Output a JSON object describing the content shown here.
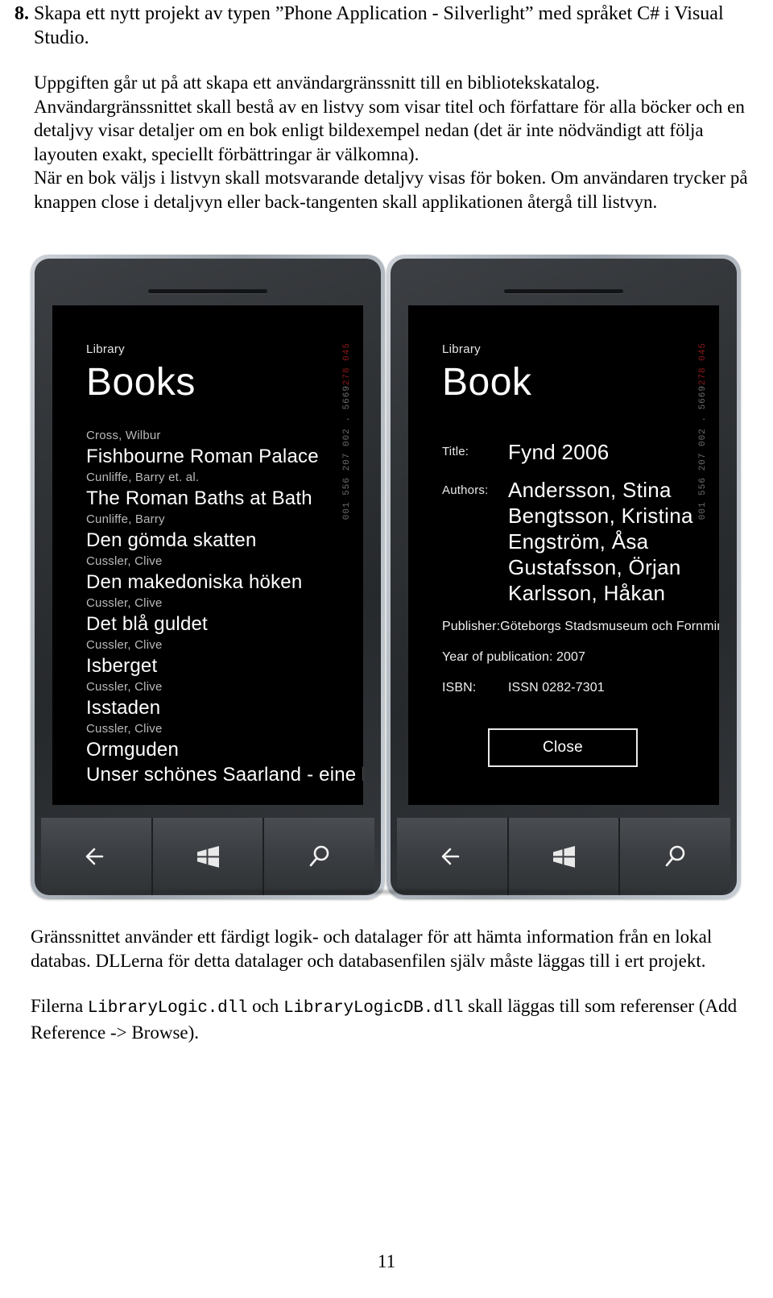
{
  "document": {
    "item_number": "8.",
    "item_text": "Skapa ett nytt projekt av typen ”Phone Application - Silverlight” med språket C#  i Visual Studio.",
    "paragraphs": [
      "Uppgiften går ut på att skapa ett användargränssnitt till en bibliotekskatalog.",
      "Användargränssnittet skall bestå av en listvy som visar titel och författare för alla böcker och en detaljvy visar detaljer om en bok enligt bildexempel nedan (det är inte nödvändigt att följa layouten exakt, speciellt förbättringar är välkomna).",
      "När en bok väljs i listvyn skall motsvarande detaljvy visas för boken. Om användaren trycker på knappen close i detaljvyn eller back-tangenten skall applikationen återgå till listvyn."
    ],
    "after_figure": {
      "paragraph": "Gränssnittet använder ett färdigt logik- och datalager för att hämta information från en lokal databas. DLLerna för detta datalager och databasenfilen själv måste läggas till i ert projekt.",
      "files_prefix": "Filerna ",
      "file_one": "LibraryLogic.dll",
      "files_middle": " och ",
      "file_two": "LibraryLogicDB.dll",
      "files_suffix": " skall läggas till som referenser (Add Reference -> Browse)."
    },
    "page_number": "11"
  },
  "figure": {
    "list_phone": {
      "screen": {
        "app_head": "Library",
        "app_title": "Books",
        "books": [
          {
            "author": "Cross, Wilbur",
            "title": "Fishbourne Roman Palace"
          },
          {
            "author": "Cunliffe, Barry et. al.",
            "title": "The Roman Baths at Bath"
          },
          {
            "author": "Cunliffe, Barry",
            "title": "Den gömda skatten"
          },
          {
            "author": "Cussler, Clive",
            "title": "Den makedoniska höken"
          },
          {
            "author": "Cussler, Clive",
            "title": "Det blå guldet"
          },
          {
            "author": "Cussler, Clive",
            "title": "Isberget"
          },
          {
            "author": "Cussler, Clive",
            "title": "Isstaden"
          },
          {
            "author": "Cussler, Clive",
            "title": "Ormguden"
          },
          {
            "author": "Cussler, Clive",
            "title": "Unser schönes Saarland - eine l"
          }
        ]
      },
      "status_strip": {
        "red": "278 045",
        "gray": "001 556  207  002 . 5669"
      },
      "hardware_buttons": [
        {
          "name": "back",
          "icon": "back-arrow-icon"
        },
        {
          "name": "start",
          "icon": "windows-logo-icon"
        },
        {
          "name": "search",
          "icon": "search-icon"
        }
      ]
    },
    "detail_phone": {
      "screen": {
        "app_head": "Library",
        "app_title": "Book",
        "title_label": "Title:",
        "title_value": "Fynd  2006",
        "authors_label": "Authors:",
        "authors": [
          "Andersson, Stina",
          "Bengtsson, Kristina",
          "Engström, Åsa",
          "Gustafsson, Örjan",
          "Karlsson, Håkan"
        ],
        "publisher_line": "Publisher:Göteborgs Stadsmuseum och Fornminne",
        "year_line": "Year of publication:  2007",
        "isbn_label": "ISBN:",
        "isbn_value": "ISSN 0282-7301",
        "close_label": "Close"
      },
      "status_strip": {
        "red": "278 045",
        "gray": "001 556  207  002 . 5669"
      },
      "hardware_buttons": [
        {
          "name": "back",
          "icon": "back-arrow-icon"
        },
        {
          "name": "start",
          "icon": "windows-logo-icon"
        },
        {
          "name": "search",
          "icon": "search-icon"
        }
      ]
    }
  },
  "colors": {
    "page_bg": "#ffffff",
    "text": "#000000",
    "screen_bg": "#000000",
    "screen_text": "#ffffff",
    "screen_subtext": "#b9b9b9",
    "bezel": "#b6bcc4",
    "body_dark": "#303336",
    "status_red": "#8b1a1a"
  }
}
